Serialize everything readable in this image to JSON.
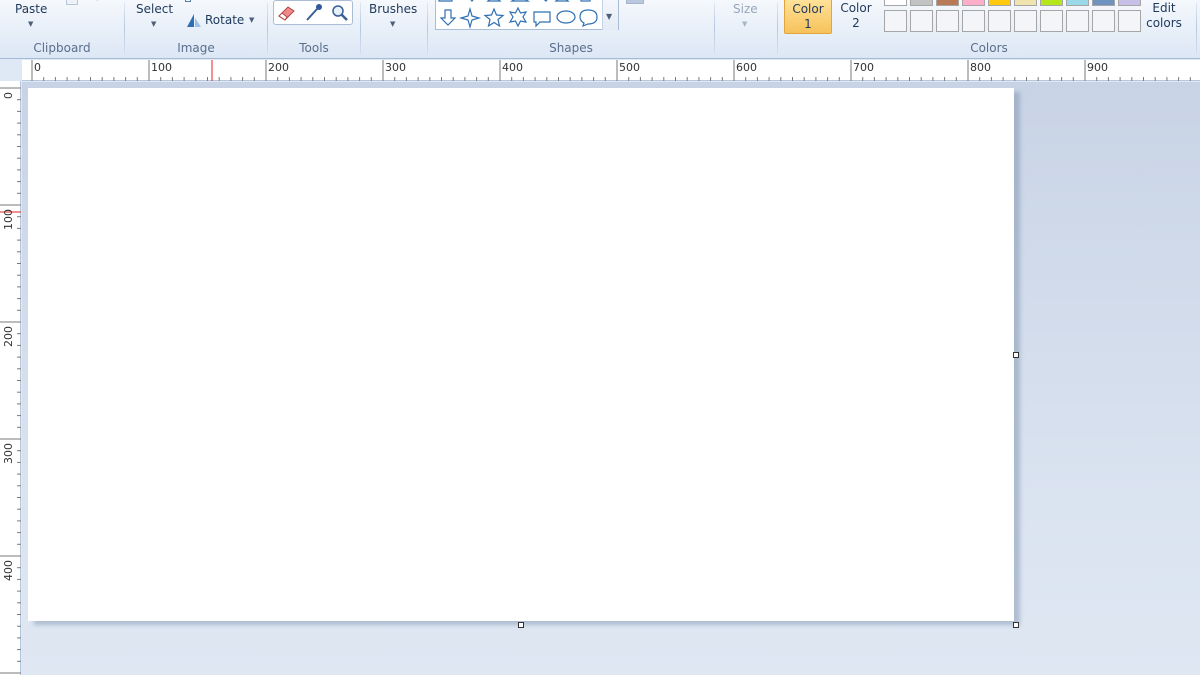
{
  "ribbon": {
    "clipboard": {
      "paste_label": "Paste",
      "group_label": "Clipboard"
    },
    "image": {
      "select_label": "Select",
      "rotate_label": "Rotate",
      "group_label": "Image"
    },
    "tools": {
      "group_label": "Tools",
      "items": [
        "eraser-icon",
        "color-picker-icon",
        "magnifier-icon"
      ]
    },
    "brushes": {
      "label": "Brushes"
    },
    "shapes": {
      "group_label": "Shapes"
    },
    "size": {
      "label": "Size"
    },
    "colors": {
      "color1_line1": "Color",
      "color1_line2": "1",
      "color2_line1": "Color",
      "color2_line2": "2",
      "edit_line1": "Edit",
      "edit_line2": "colors",
      "group_label": "Colors",
      "palette_top": [
        "#ffffff",
        "#c3c3c3",
        "#b97a57",
        "#ffaec9",
        "#ffc90e",
        "#efe4b0",
        "#b5e61d",
        "#99d9ea",
        "#7092be",
        "#c8bfe7"
      ]
    }
  },
  "ruler": {
    "horizontal": [
      "0",
      "100",
      "200",
      "300",
      "400",
      "500",
      "600",
      "700",
      "800",
      "900"
    ],
    "vertical": [
      "0",
      "100",
      "200",
      "300",
      "400"
    ]
  },
  "colors": {
    "canvas": "#ffffff",
    "accent": "#f7c25b",
    "marker": "#e02020"
  }
}
